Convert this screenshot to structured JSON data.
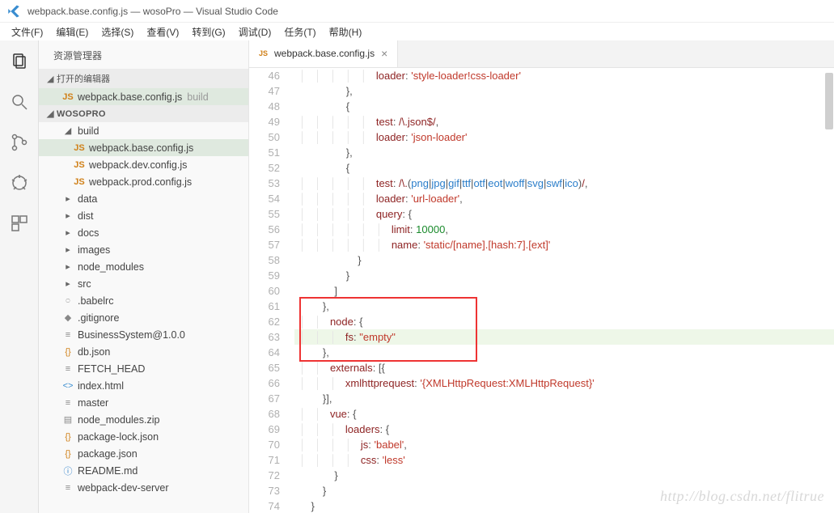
{
  "window": {
    "title": "webpack.base.config.js — wosoPro — Visual Studio Code"
  },
  "menubar": [
    "文件(F)",
    "编辑(E)",
    "选择(S)",
    "查看(V)",
    "转到(G)",
    "调试(D)",
    "任务(T)",
    "帮助(H)"
  ],
  "sidebar": {
    "title": "资源管理器",
    "sections": {
      "openEditors": {
        "label": "打开的编辑器"
      },
      "workspace": {
        "label": "WOSOPRO"
      }
    },
    "openEditorItems": [
      {
        "icon": "JS",
        "iconClass": "ic-js",
        "label": "webpack.base.config.js",
        "suffix": "build",
        "selected": true
      }
    ],
    "tree": [
      {
        "ind": 1,
        "icon": "▸",
        "iconClass": "ic-folder",
        "label": "build",
        "expanded": true
      },
      {
        "ind": 2,
        "icon": "JS",
        "iconClass": "ic-js",
        "label": "webpack.base.config.js",
        "selected": true
      },
      {
        "ind": 2,
        "icon": "JS",
        "iconClass": "ic-js",
        "label": "webpack.dev.config.js"
      },
      {
        "ind": 2,
        "icon": "JS",
        "iconClass": "ic-js",
        "label": "webpack.prod.config.js"
      },
      {
        "ind": 1,
        "icon": "▸",
        "iconClass": "ic-folder",
        "label": "data"
      },
      {
        "ind": 1,
        "icon": "▸",
        "iconClass": "ic-folder",
        "label": "dist"
      },
      {
        "ind": 1,
        "icon": "▸",
        "iconClass": "ic-folder",
        "label": "docs"
      },
      {
        "ind": 1,
        "icon": "▸",
        "iconClass": "ic-folder",
        "label": "images"
      },
      {
        "ind": 1,
        "icon": "▸",
        "iconClass": "ic-folder",
        "label": "node_modules"
      },
      {
        "ind": 1,
        "icon": "▸",
        "iconClass": "ic-folder",
        "label": "src"
      },
      {
        "ind": 1,
        "icon": "೦",
        "iconClass": "ic-file",
        "label": ".babelrc"
      },
      {
        "ind": 1,
        "icon": "◆",
        "iconClass": "ic-file",
        "label": ".gitignore"
      },
      {
        "ind": 1,
        "icon": "≡",
        "iconClass": "ic-file",
        "label": "BusinessSystem@1.0.0"
      },
      {
        "ind": 1,
        "icon": "{}",
        "iconClass": "ic-json",
        "label": "db.json"
      },
      {
        "ind": 1,
        "icon": "≡",
        "iconClass": "ic-file",
        "label": "FETCH_HEAD"
      },
      {
        "ind": 1,
        "icon": "<>",
        "iconClass": "ic-html",
        "label": "index.html"
      },
      {
        "ind": 1,
        "icon": "≡",
        "iconClass": "ic-file",
        "label": "master"
      },
      {
        "ind": 1,
        "icon": "▤",
        "iconClass": "ic-file",
        "label": "node_modules.zip"
      },
      {
        "ind": 1,
        "icon": "{}",
        "iconClass": "ic-json",
        "label": "package-lock.json"
      },
      {
        "ind": 1,
        "icon": "{}",
        "iconClass": "ic-json",
        "label": "package.json"
      },
      {
        "ind": 1,
        "icon": "ⓘ",
        "iconClass": "ic-info",
        "label": "README.md"
      },
      {
        "ind": 1,
        "icon": "≡",
        "iconClass": "ic-file",
        "label": "webpack-dev-server"
      }
    ]
  },
  "tab": {
    "label": "webpack.base.config.js"
  },
  "code": {
    "startLine": 46,
    "lines": [
      {
        "t": "                    loader: 'style-loader!css-loader'",
        "segs": [
          [
            "                    ",
            "p"
          ],
          [
            "loader",
            1
          ],
          [
            ": ",
            0
          ],
          [
            "'style-loader!css-loader'",
            2
          ]
        ]
      },
      {
        "t": "                },",
        "segs": [
          [
            "                },",
            0
          ]
        ]
      },
      {
        "t": "                {",
        "segs": [
          [
            "                {",
            0
          ]
        ]
      },
      {
        "t": "                    test: /\\.json$/,",
        "segs": [
          [
            "                    ",
            "p"
          ],
          [
            "test",
            1
          ],
          [
            ": ",
            0
          ],
          [
            "/\\.json$/",
            3
          ],
          [
            ",",
            0
          ]
        ]
      },
      {
        "t": "                    loader: 'json-loader'",
        "segs": [
          [
            "                    ",
            "p"
          ],
          [
            "loader",
            1
          ],
          [
            ": ",
            0
          ],
          [
            "'json-loader'",
            2
          ]
        ]
      },
      {
        "t": "                },",
        "segs": [
          [
            "                },",
            0
          ]
        ]
      },
      {
        "t": "                {",
        "segs": [
          [
            "                {",
            0
          ]
        ]
      },
      {
        "t": "                    test: /\\.(png|jpg|gif|ttf|otf|eot|woff|svg|swf|ico)/,",
        "segs": [
          [
            "                    ",
            "p"
          ],
          [
            "test",
            1
          ],
          [
            ": ",
            0
          ],
          [
            "/\\.",
            3
          ],
          [
            "(",
            0
          ],
          [
            "png",
            5
          ],
          [
            "|",
            0
          ],
          [
            "jpg",
            5
          ],
          [
            "|",
            0
          ],
          [
            "gif",
            5
          ],
          [
            "|",
            0
          ],
          [
            "ttf",
            5
          ],
          [
            "|",
            0
          ],
          [
            "otf",
            5
          ],
          [
            "|",
            0
          ],
          [
            "eot",
            5
          ],
          [
            "|",
            0
          ],
          [
            "woff",
            5
          ],
          [
            "|",
            0
          ],
          [
            "svg",
            5
          ],
          [
            "|",
            0
          ],
          [
            "swf",
            5
          ],
          [
            "|",
            0
          ],
          [
            "ico",
            5
          ],
          [
            ")",
            0
          ],
          [
            "/",
            3
          ],
          [
            ",",
            0
          ]
        ]
      },
      {
        "t": "                    loader: 'url-loader',",
        "segs": [
          [
            "                    ",
            "p"
          ],
          [
            "loader",
            1
          ],
          [
            ": ",
            0
          ],
          [
            "'url-loader'",
            2
          ],
          [
            ",",
            0
          ]
        ]
      },
      {
        "t": "                    query: {",
        "segs": [
          [
            "                    ",
            "p"
          ],
          [
            "query",
            1
          ],
          [
            ": {",
            0
          ]
        ]
      },
      {
        "t": "                        limit: 10000,",
        "segs": [
          [
            "                        ",
            "p"
          ],
          [
            "limit",
            1
          ],
          [
            ": ",
            0
          ],
          [
            "10000",
            4
          ],
          [
            ",",
            0
          ]
        ]
      },
      {
        "t": "                        name: 'static/[name].[hash:7].[ext]'",
        "segs": [
          [
            "                        ",
            "p"
          ],
          [
            "name",
            1
          ],
          [
            ": ",
            0
          ],
          [
            "'static/[name].[hash:7].[ext]'",
            2
          ]
        ]
      },
      {
        "t": "                    }",
        "segs": [
          [
            "                    }",
            0
          ]
        ]
      },
      {
        "t": "                }",
        "segs": [
          [
            "                }",
            0
          ]
        ]
      },
      {
        "t": "            ]",
        "segs": [
          [
            "            ]",
            0
          ]
        ]
      },
      {
        "t": "        },",
        "segs": [
          [
            "        },",
            0
          ]
        ]
      },
      {
        "t": "        node: {",
        "segs": [
          [
            "        ",
            "p"
          ],
          [
            "node",
            1
          ],
          [
            ": {",
            0
          ]
        ]
      },
      {
        "t": "            fs: \"empty\"",
        "hl": true,
        "segs": [
          [
            "            ",
            "p"
          ],
          [
            "fs",
            1
          ],
          [
            ": ",
            0
          ],
          [
            "\"empty\"",
            2
          ]
        ]
      },
      {
        "t": "        },",
        "segs": [
          [
            "        },",
            0
          ]
        ]
      },
      {
        "t": "        externals: [{",
        "segs": [
          [
            "        ",
            "p"
          ],
          [
            "externals",
            1
          ],
          [
            ": [{",
            0
          ]
        ]
      },
      {
        "t": "            xmlhttprequest: '{XMLHttpRequest:XMLHttpRequest}'",
        "segs": [
          [
            "            ",
            "p"
          ],
          [
            "xmlhttprequest",
            1
          ],
          [
            ": ",
            0
          ],
          [
            "'{XMLHttpRequest:XMLHttpRequest}'",
            2
          ]
        ]
      },
      {
        "t": "        }],",
        "segs": [
          [
            "        }],",
            0
          ]
        ]
      },
      {
        "t": "        vue: {",
        "segs": [
          [
            "        ",
            "p"
          ],
          [
            "vue",
            1
          ],
          [
            ": {",
            0
          ]
        ]
      },
      {
        "t": "            loaders: {",
        "segs": [
          [
            "            ",
            "p"
          ],
          [
            "loaders",
            1
          ],
          [
            ": {",
            0
          ]
        ]
      },
      {
        "t": "                js: 'babel',",
        "segs": [
          [
            "                ",
            "p"
          ],
          [
            "js",
            1
          ],
          [
            ": ",
            0
          ],
          [
            "'babel'",
            2
          ],
          [
            ",",
            0
          ]
        ]
      },
      {
        "t": "                css: 'less'",
        "segs": [
          [
            "                ",
            "p"
          ],
          [
            "css",
            1
          ],
          [
            ": ",
            0
          ],
          [
            "'less'",
            2
          ]
        ]
      },
      {
        "t": "            }",
        "segs": [
          [
            "            }",
            0
          ]
        ]
      },
      {
        "t": "        }",
        "segs": [
          [
            "        }",
            0
          ]
        ]
      },
      {
        "t": "    }",
        "segs": [
          [
            "    }",
            0
          ]
        ]
      }
    ]
  },
  "redbox": {
    "firstLine": 61,
    "lastLine": 64
  },
  "watermark": "http://blog.csdn.net/flitrue"
}
